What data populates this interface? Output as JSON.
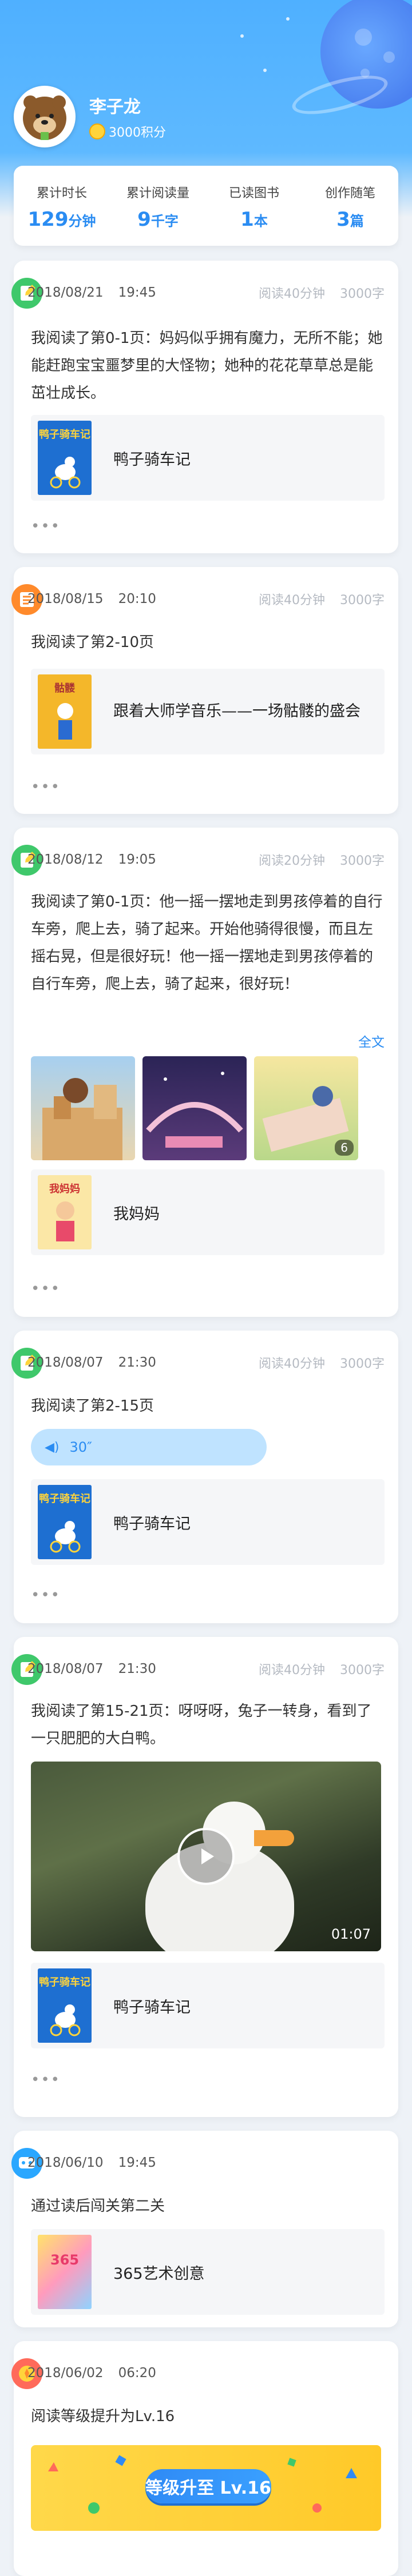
{
  "profile": {
    "name": "李子龙",
    "points": "3000积分"
  },
  "stats": [
    {
      "label": "累计时长",
      "value": "129",
      "unit": "分钟"
    },
    {
      "label": "累计阅读量",
      "value": "9",
      "unit": "千字"
    },
    {
      "label": "已读图书",
      "value": "1",
      "unit": "本"
    },
    {
      "label": "创作随笔",
      "value": "3",
      "unit": "篇"
    }
  ],
  "feed": [
    {
      "date": "2018/08/21",
      "time": "19:45",
      "duration": "阅读40分钟",
      "words": "3000字",
      "text": "我阅读了第0-1页：妈妈似乎拥有魔力，无所不能；她能赶跑宝宝噩梦里的大怪物；她种的花花草草总是能茁壮成长。",
      "book": "鸭子骑车记",
      "cover_title": "鸭子骑车记",
      "more": "•••"
    },
    {
      "date": "2018/08/15",
      "time": "20:10",
      "duration": "阅读40分钟",
      "words": "3000字",
      "text": "我阅读了第2-10页",
      "book": "跟着大师学音乐——一场骷髅的盛会",
      "cover_title": "骷髅",
      "more": "•••"
    },
    {
      "date": "2018/08/12",
      "time": "19:05",
      "duration": "阅读20分钟",
      "words": "3000字",
      "text": "我阅读了第0-1页：他一摇一摆地走到男孩停着的自行车旁，爬上去，骑了起来。开始他骑得很慢，而且左摇右晃，但是很好玩！他一摇一摆地走到男孩停着的自行车旁，爬上去，骑了起来，很好玩！",
      "full_text_link": "全文",
      "photo_count": "6",
      "book": "我妈妈",
      "cover_title": "我妈妈",
      "more": "•••"
    },
    {
      "date": "2018/08/07",
      "time": "21:30",
      "duration": "阅读40分钟",
      "words": "3000字",
      "text": "我阅读了第2-15页",
      "audio": "30″",
      "book": "鸭子骑车记",
      "cover_title": "鸭子骑车记",
      "more": "•••"
    },
    {
      "date": "2018/08/07",
      "time": "21:30",
      "duration": "阅读40分钟",
      "words": "3000字",
      "text": "我阅读了第15-21页：呀呀呀，兔子一转身，看到了一只肥肥的大白鸭。",
      "video_time": "01:07",
      "book": "鸭子骑车记",
      "cover_title": "鸭子骑车记",
      "more": "•••"
    },
    {
      "date": "2018/06/10",
      "time": "19:45",
      "text": "通过读后闯关第二关",
      "book": "365艺术创意",
      "cover_title": "365"
    },
    {
      "date": "2018/06/02",
      "time": "06:20",
      "text": "阅读等级提升为Lv.16",
      "banner": "等级升至 Lv.16"
    }
  ],
  "colors": {
    "accent": "#2a8cf2",
    "header": "#4fb0ff",
    "muted": "#b5bac2"
  }
}
